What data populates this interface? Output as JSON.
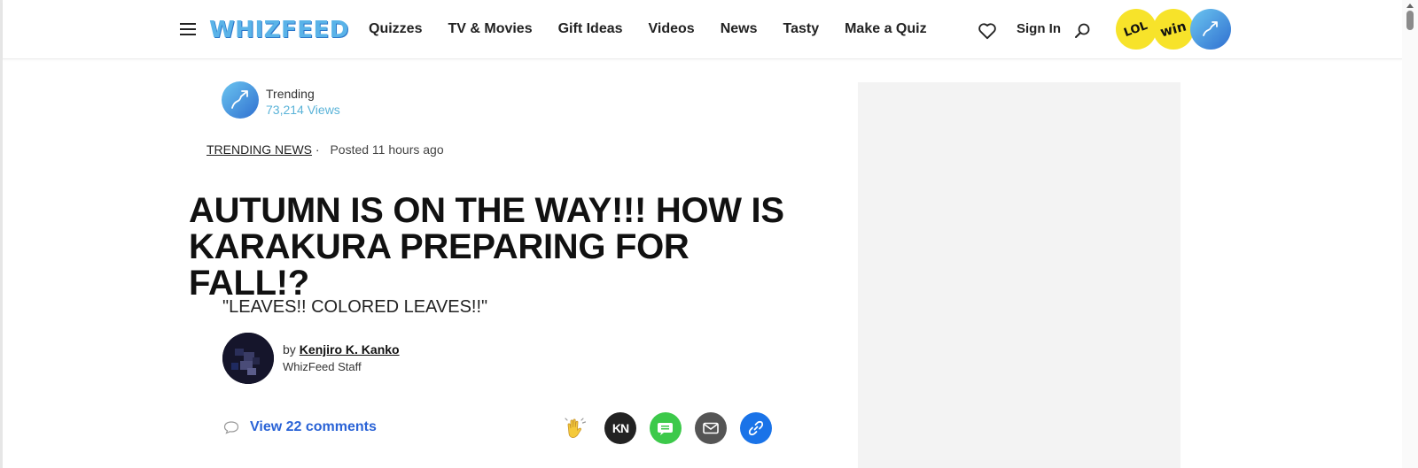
{
  "header": {
    "logo": "WHIZFEED",
    "nav": [
      "Quizzes",
      "TV & Movies",
      "Gift Ideas",
      "Videos",
      "News",
      "Tasty",
      "Make a Quiz"
    ],
    "sign_in": "Sign In",
    "badges": {
      "lol": "LOL",
      "win": "win"
    }
  },
  "trending": {
    "label": "Trending",
    "views": "73,214 Views"
  },
  "article": {
    "category": "TRENDING NEWS",
    "separator": "·",
    "posted": "Posted 11 hours ago",
    "title": "AUTUMN IS ON THE WAY!!! HOW IS KARAKURA PREPARING FOR FALL!?",
    "subtitle": "\"LEAVES!! COLORED LEAVES!!\"",
    "author": {
      "by": "by",
      "name": "Kenjiro K. Kanko",
      "role": "WhizFeed Staff"
    },
    "comments_label": "View 22 comments",
    "share_kn_text": "KN"
  },
  "icons": {
    "menu": "hamburger-icon",
    "favorite": "heart-icon",
    "search": "search-icon",
    "comment": "comment-bubble-icon",
    "share": [
      "clap-icon",
      "kn-share-icon",
      "message-icon",
      "mail-icon",
      "link-icon"
    ]
  },
  "colors": {
    "logo": "#5ab3e8",
    "link_blue": "#2a63d6",
    "badge_yellow": "#f7e32a",
    "views_blue": "#5ab3d8"
  }
}
